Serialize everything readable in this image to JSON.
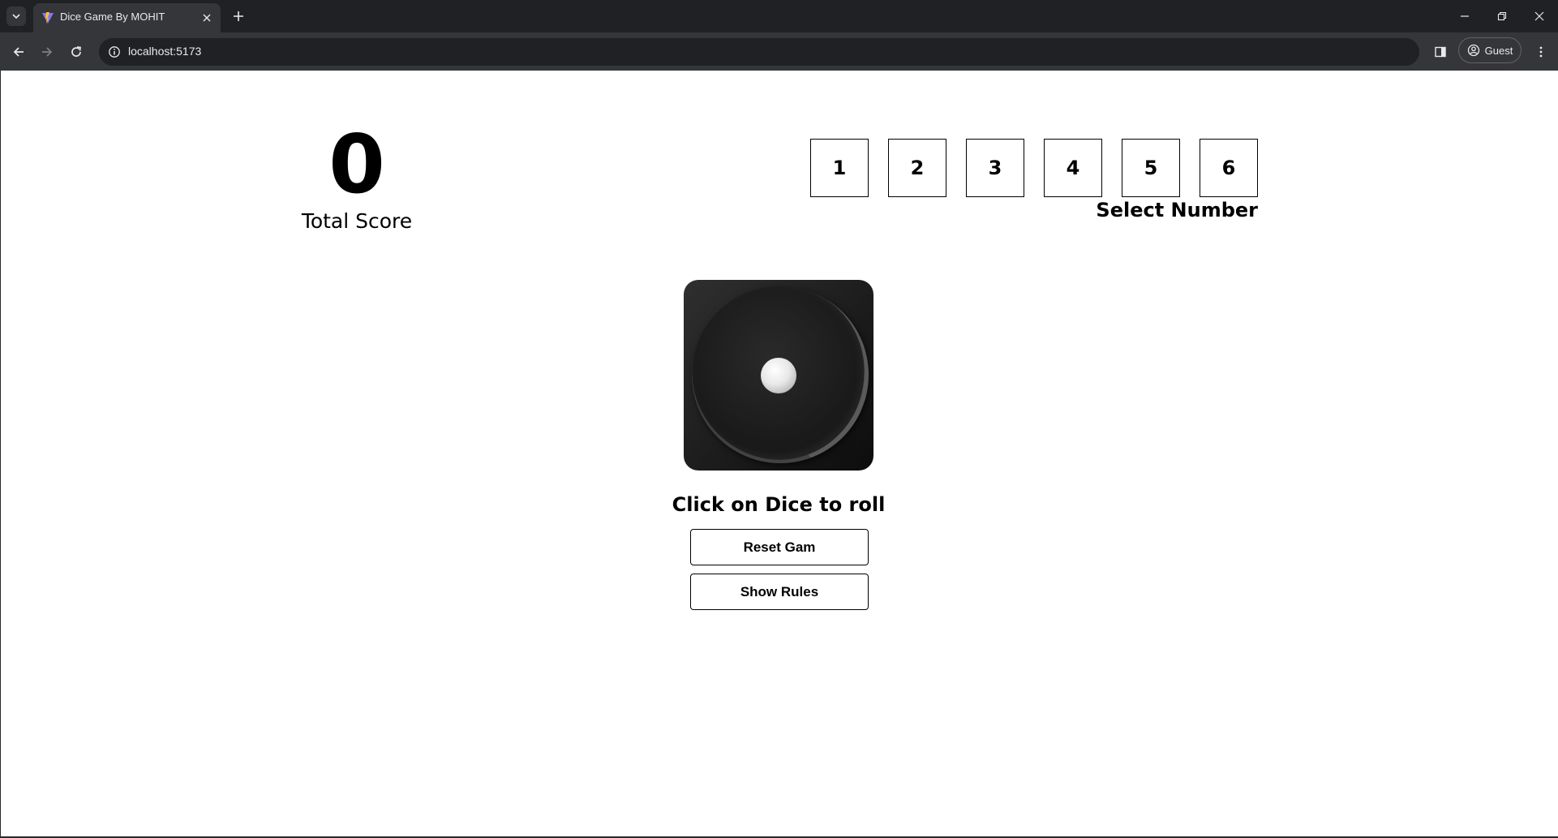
{
  "browser": {
    "tab_title": "Dice Game By MOHIT",
    "url": "localhost:5173",
    "profile_label": "Guest"
  },
  "game": {
    "total_score": "0",
    "total_score_label": "Total Score",
    "numbers": [
      "1",
      "2",
      "3",
      "4",
      "5",
      "6"
    ],
    "select_label": "Select Number",
    "dice_value": 1,
    "roll_hint": "Click on Dice to roll",
    "reset_button": "Reset Gam",
    "rules_button": "Show Rules"
  },
  "colors": {
    "chrome_dark": "#202124",
    "chrome_toolbar": "#35363a",
    "page_bg": "#ffffff",
    "text": "#000000",
    "dice_body": "#1c1c1c"
  }
}
